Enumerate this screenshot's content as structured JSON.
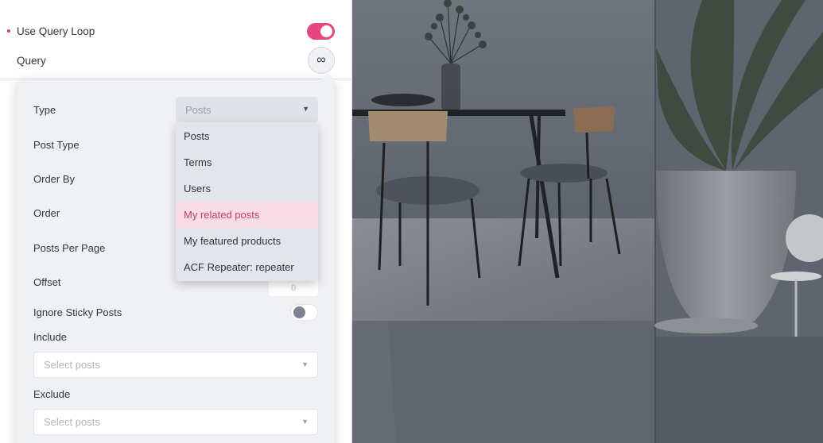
{
  "settings": {
    "use_query_loop_label": "Use Query Loop",
    "use_query_loop_on": true,
    "query_label": "Query",
    "link_icon": "infinity-link-icon"
  },
  "popover": {
    "type_label": "Type",
    "type_value": "Posts",
    "post_type_label": "Post Type",
    "order_by_label": "Order By",
    "order_label": "Order",
    "posts_per_page_label": "Posts Per Page",
    "offset_label": "Offset",
    "offset_value": "0",
    "ignore_sticky_label": "Ignore Sticky Posts",
    "ignore_sticky_on": false,
    "include_label": "Include",
    "include_placeholder": "Select posts",
    "exclude_label": "Exclude",
    "exclude_placeholder": "Select posts"
  },
  "dropdown": {
    "options": [
      "Posts",
      "Terms",
      "Users",
      "My related posts",
      "My featured products",
      "ACF Repeater: repeater"
    ],
    "highlighted": "My related posts"
  },
  "colors": {
    "accent": "#e6457e",
    "highlight_bg": "#f8dde7"
  }
}
